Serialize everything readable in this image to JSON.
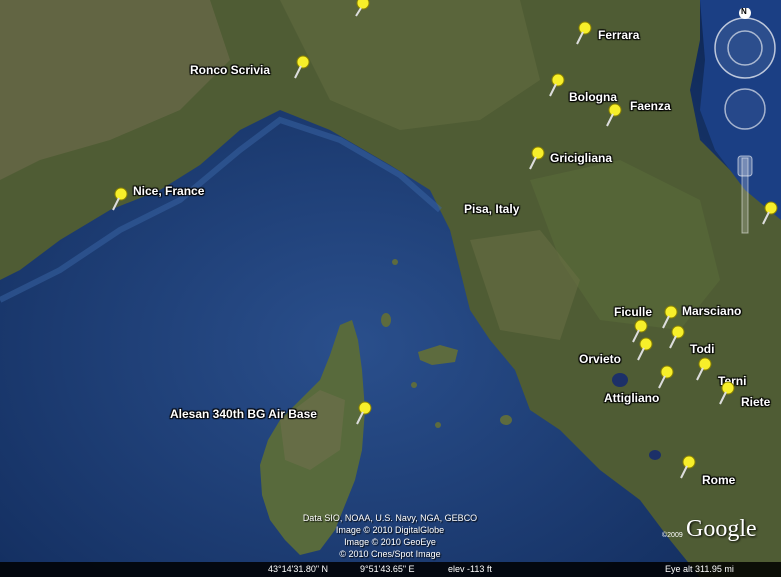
{
  "locations": [
    {
      "label": "Ferrara"
    },
    {
      "label": "Ronco Scrivia"
    },
    {
      "label": "Bologna"
    },
    {
      "label": "Faenza"
    },
    {
      "label": "Griciglianа"
    },
    {
      "label": "Nice, France"
    },
    {
      "label": "Pisa, Italy"
    },
    {
      "label": "Ficulle"
    },
    {
      "label": "Marsciano"
    },
    {
      "label": "Orvieto"
    },
    {
      "label": "Todi"
    },
    {
      "label": "Terni"
    },
    {
      "label": "Attigliano"
    },
    {
      "label": "Riete"
    },
    {
      "label": "Alesan  340th BG Air Base"
    },
    {
      "label": "Rome"
    }
  ],
  "credits": {
    "line1": "Data SIO, NOAA, U.S. Navy, NGA, GEBCO",
    "line2": "Image © 2010 DigitalGlobe",
    "line3": "Image © 2010 GeoEye",
    "line4": "© 2010 Cnes/Spot Image"
  },
  "status": {
    "lat": "43°14'31.80\" N",
    "lon": "9°51'43.65\" E",
    "elev": "elev  -113 ft",
    "eye_alt": "Eye alt   311.95 mi"
  },
  "logo": {
    "text": "Google",
    "year": "©2009"
  },
  "nav": {
    "north": "N"
  },
  "colors": {
    "sea": "#1c3f7a",
    "land": "#4d5a33",
    "pin": "#f7ef2a"
  }
}
